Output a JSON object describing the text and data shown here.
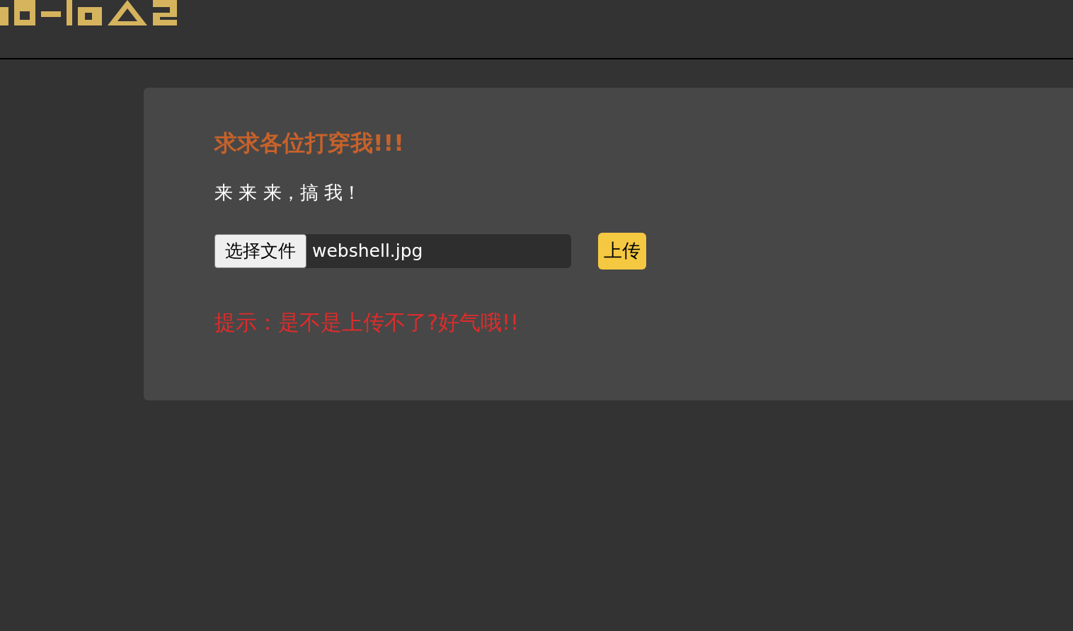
{
  "card": {
    "title": "求求各位打穿我!!!",
    "text": "来 来 来，搞 我！",
    "file_input": {
      "button": "选择文件",
      "filename": "webshell.jpg"
    },
    "upload_button": "上传",
    "hint": "提示：是不是上传不了?好气哦!!"
  }
}
